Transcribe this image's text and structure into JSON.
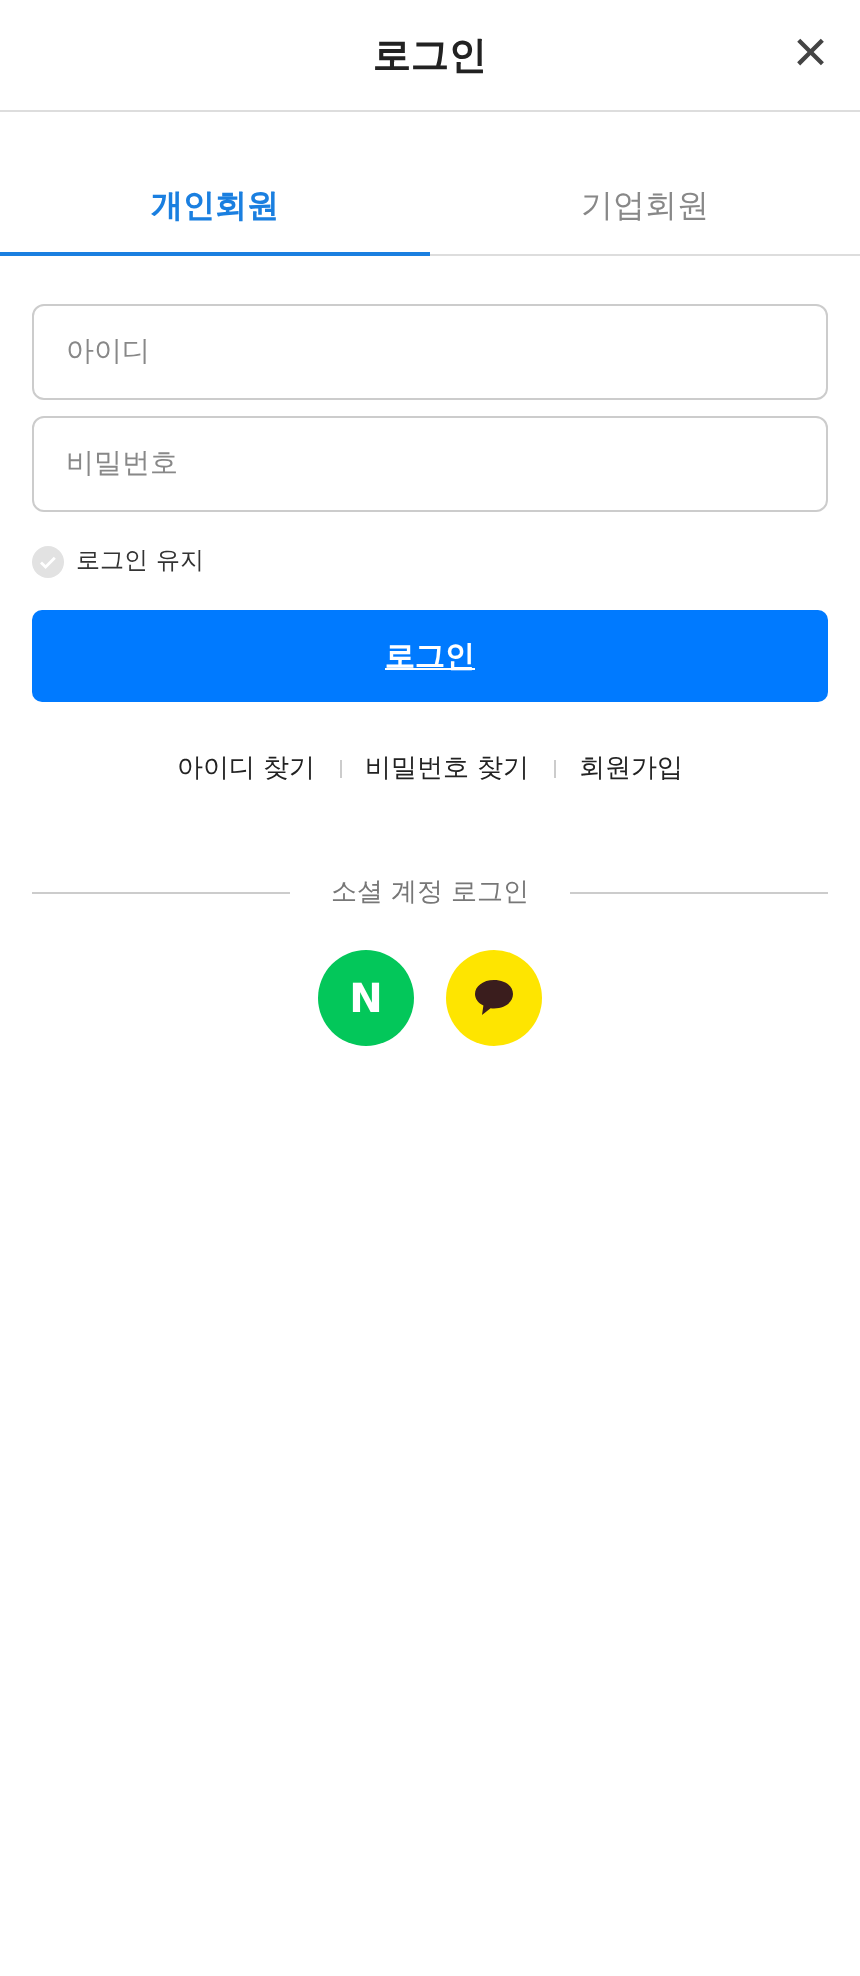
{
  "header": {
    "title": "로그인",
    "close": "×"
  },
  "tabs": [
    {
      "label": "개인회원",
      "selected": true
    },
    {
      "label": "기업회원",
      "selected": false
    }
  ],
  "fields": [
    {
      "placeholder": "아이디"
    },
    {
      "placeholder": "비밀번호"
    }
  ],
  "keep_login": {
    "label": "로그인 유지",
    "checked": false
  },
  "login_button": "로그인",
  "links": [
    "아이디 찾기",
    "비밀번호 찾기",
    "회원가입"
  ],
  "social": {
    "title": "소셜 계정 로그인",
    "buttons": [
      {
        "kind": "naver",
        "text": "N",
        "color": "#03c75a"
      },
      {
        "kind": "kakao",
        "color": "#fee500"
      }
    ]
  }
}
